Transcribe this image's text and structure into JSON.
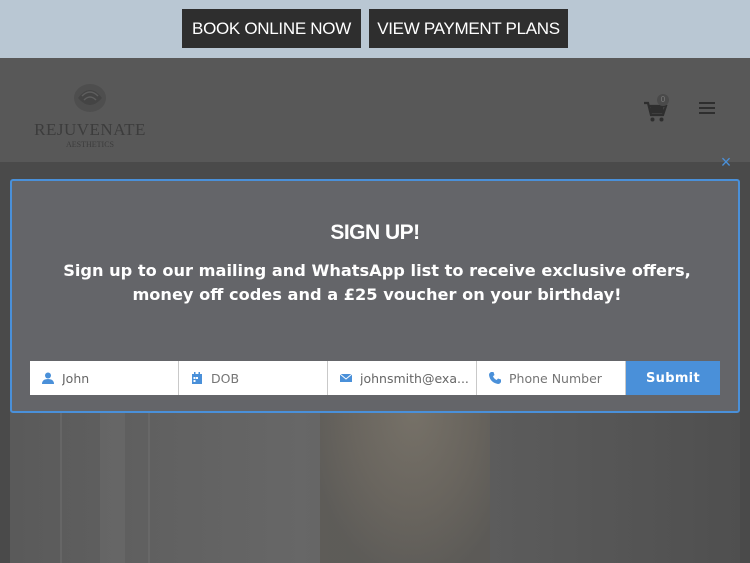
{
  "topbar": {
    "book_label": "BOOK ONLINE NOW",
    "plans_label": "VIEW PAYMENT PLANS"
  },
  "header": {
    "logo_text": "REJUVENATE",
    "logo_subtext": "AESTHETICS",
    "cart_count": "0"
  },
  "modal": {
    "close_label": "×",
    "title": "SIGN UP!",
    "text": "Sign up to our mailing and WhatsApp list to receive exclusive offers, money off codes and a £25 voucher on your birthday!",
    "fields": {
      "name": {
        "value": "John"
      },
      "dob": {
        "placeholder": "DOB"
      },
      "email": {
        "value": "johnsmith@exa..."
      },
      "phone": {
        "placeholder": "Phone Number"
      }
    },
    "submit_label": "Submit"
  },
  "colors": {
    "accent": "#4a90d9",
    "topbar_bg": "#b9c7d3",
    "button_dark": "#2e2e2e",
    "modal_bg": "#646569"
  },
  "icons": {
    "name_field": "user-icon",
    "dob_field": "calendar-icon",
    "email_field": "envelope-icon",
    "phone_field": "phone-icon",
    "cart": "shopping-cart-icon",
    "menu": "hamburger-menu-icon",
    "close": "close-icon"
  }
}
